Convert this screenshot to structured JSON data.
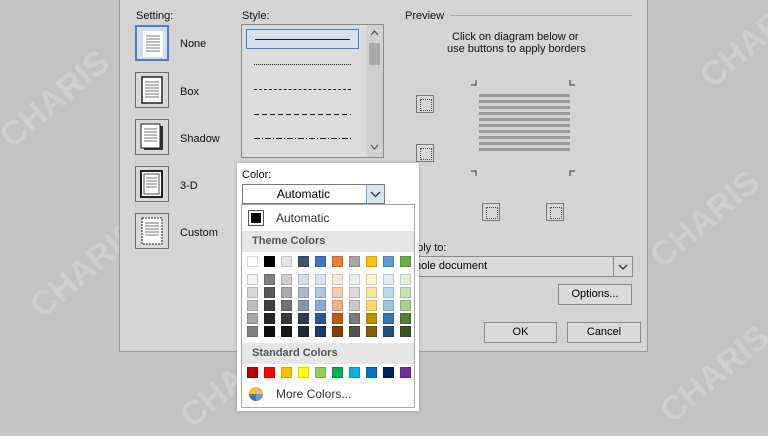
{
  "setting": {
    "label": "Setting:",
    "items": [
      {
        "key": "none",
        "label": "None"
      },
      {
        "key": "box",
        "label": "Box"
      },
      {
        "key": "shadow",
        "label": "Shadow"
      },
      {
        "key": "3d",
        "label": "3-D"
      },
      {
        "key": "custom",
        "label": "Custom"
      }
    ],
    "selected": "none"
  },
  "style": {
    "label": "Style:",
    "selected_index": 0
  },
  "color": {
    "label": "Color:",
    "value": "Automatic",
    "dropdown": {
      "automatic_label": "Automatic",
      "theme_header": "Theme Colors",
      "theme_top": [
        "#ffffff",
        "#000000",
        "#e7e6e6",
        "#44546a",
        "#4472c4",
        "#ed7d31",
        "#a5a5a5",
        "#ffc000",
        "#5b9bd5",
        "#70ad47"
      ],
      "theme_shades": [
        [
          "#f2f2f2",
          "#d9d9d9",
          "#bfbfbf",
          "#a6a6a6",
          "#808080"
        ],
        [
          "#808080",
          "#595959",
          "#404040",
          "#262626",
          "#0d0d0d"
        ],
        [
          "#d0cece",
          "#aeaaaa",
          "#757171",
          "#3a3838",
          "#171616"
        ],
        [
          "#d6dce4",
          "#adb9ca",
          "#8497b0",
          "#333f4f",
          "#222a35"
        ],
        [
          "#d9e2f3",
          "#b4c6e7",
          "#8eaadb",
          "#2f5496",
          "#1f3864"
        ],
        [
          "#fbe5d5",
          "#f7cbac",
          "#f4b183",
          "#c55a11",
          "#833c0b"
        ],
        [
          "#ededed",
          "#dbdbdb",
          "#c9c9c9",
          "#7b7b7b",
          "#525252"
        ],
        [
          "#fff2cc",
          "#fee599",
          "#ffd965",
          "#bf9000",
          "#7f6000"
        ],
        [
          "#deebf6",
          "#bdd7ee",
          "#9cc3e5",
          "#2e75b5",
          "#1e4e79"
        ],
        [
          "#e2efd9",
          "#c5e0b3",
          "#a8d08d",
          "#538135",
          "#375623"
        ]
      ],
      "standard_header": "Standard Colors",
      "standard": [
        "#c00000",
        "#ff0000",
        "#ffc000",
        "#ffff00",
        "#92d050",
        "#00b050",
        "#00b0f0",
        "#0070c0",
        "#002060",
        "#7030a0"
      ],
      "more_label": "More Colors..."
    }
  },
  "preview": {
    "label": "Preview",
    "hint_line1": "Click on diagram below or",
    "hint_line2": "use buttons to apply borders"
  },
  "apply_to": {
    "label": "pply to:",
    "value": "hole document"
  },
  "buttons": {
    "options": "Options...",
    "ok": "OK",
    "cancel": "Cancel"
  },
  "watermark": "CHARIS"
}
